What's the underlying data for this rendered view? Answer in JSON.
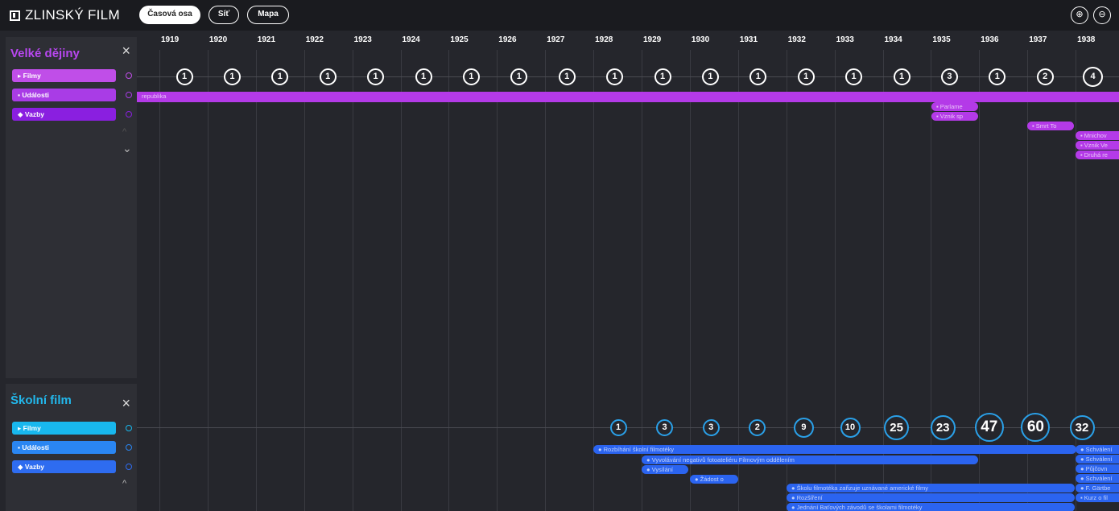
{
  "app": {
    "title": "ZLINSKÝ FILM"
  },
  "tabs": [
    {
      "label": "Časová osa",
      "active": true
    },
    {
      "label": "Síť",
      "active": false
    },
    {
      "label": "Mapa",
      "active": false
    }
  ],
  "zoom": {
    "in_icon": "zoom-in-icon",
    "out_icon": "zoom-out-icon"
  },
  "years": [
    "1919",
    "1920",
    "1921",
    "1922",
    "1923",
    "1924",
    "1925",
    "1926",
    "1927",
    "1928",
    "1929",
    "1930",
    "1931",
    "1932",
    "1933",
    "1934",
    "1935",
    "1936",
    "1937",
    "1938"
  ],
  "panel_top": {
    "title": "Velké dějiny",
    "close": "×",
    "layers": [
      {
        "label": "▸ Filmy",
        "color": "#c04ee8"
      },
      {
        "label": "▪ Události",
        "color": "#a93ce6"
      },
      {
        "label": "◆ Vazby",
        "color": "#8a1fe0"
      }
    ],
    "chev_up": "^",
    "chev_down": "⌄",
    "counts": [
      "1",
      "1",
      "1",
      "1",
      "1",
      "1",
      "1",
      "1",
      "1",
      "1",
      "1",
      "1",
      "1",
      "1",
      "1",
      "1",
      "1",
      "3",
      "1",
      "2",
      "4"
    ],
    "main_bar": "republika",
    "events": [
      {
        "label": "▪ Parlame"
      },
      {
        "label": "▪ Vznik sp"
      },
      {
        "label": "▪ Smrt To"
      },
      {
        "label": "▪ Mnichov"
      },
      {
        "label": "▪ Vznik Ve"
      },
      {
        "label": "▪ Druhá re"
      }
    ]
  },
  "panel_bottom": {
    "title": "Školní film",
    "close": "×",
    "layers": [
      {
        "label": "▸ Filmy",
        "color": "#18b8ee"
      },
      {
        "label": "▪ Události",
        "color": "#2a86f2"
      },
      {
        "label": "◆ Vazby",
        "color": "#2e6cf0"
      }
    ],
    "chev_up": "^",
    "counts": [
      "1",
      "3",
      "3",
      "2",
      "9",
      "10",
      "25",
      "23",
      "47",
      "60",
      "32"
    ],
    "events": [
      {
        "label": "● Rozbíhání školní filmotéky"
      },
      {
        "label": "● Vyvolávání negativů fotoateliéru Filmovým oddělením"
      },
      {
        "label": "● Vysílání"
      },
      {
        "label": "● Žádost o"
      },
      {
        "label": "● Školu filmotéka zařizuje uznávané americké filmy"
      },
      {
        "label": "● Rozšíření"
      },
      {
        "label": "● Jednání Baťových závodů se školami filmotéky"
      },
      {
        "label": "● Schválení"
      },
      {
        "label": "● Schválení"
      },
      {
        "label": "● Půjčovn"
      },
      {
        "label": "● Schválení"
      },
      {
        "label": "● F. Gärtbe"
      },
      {
        "label": "▪ Kurz o fil"
      }
    ]
  }
}
